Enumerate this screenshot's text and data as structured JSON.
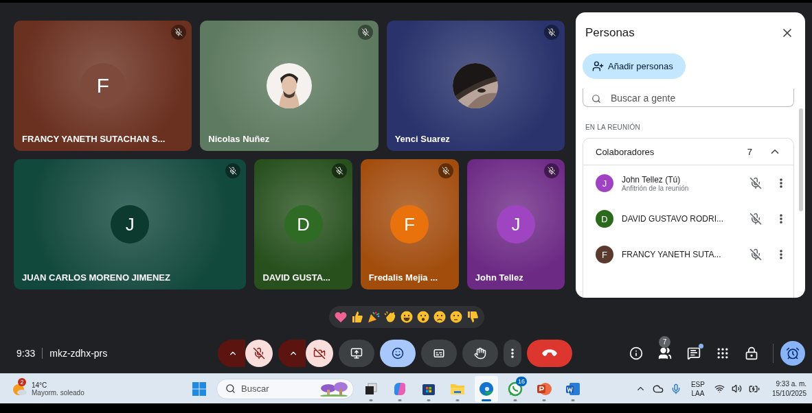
{
  "tiles": [
    [
      {
        "name": "FRANCY YANETH SUTACHAN S...",
        "color": "#6a3020",
        "avatar": {
          "kind": "letter",
          "letter": "F",
          "color": "#7d4a3b"
        }
      },
      {
        "name": "Nicolas Nuñez",
        "color": "#5e7a60"
      },
      {
        "name": "Yenci Suarez",
        "color": "#2a336c"
      }
    ],
    [
      {
        "name": "JUAN CARLOS MORENO JIMENEZ",
        "color": "#12493d",
        "avatar": {
          "kind": "letter",
          "letter": "J",
          "color": "#0d3a2f"
        }
      },
      {
        "name": "DAVID GUSTA...",
        "color": "#27501d",
        "avatar": {
          "kind": "letter",
          "letter": "D",
          "color": "#2f6b24"
        }
      },
      {
        "name": "Fredalis Mejia ...",
        "color": "#a24d0c",
        "avatar": {
          "kind": "letter",
          "letter": "F",
          "color": "#ea720c"
        }
      },
      {
        "name": "John Tellez",
        "color": "#6d2a85",
        "avatar": {
          "kind": "letter",
          "letter": "J",
          "color": "#a045c2"
        }
      }
    ]
  ],
  "panel": {
    "title": "Personas",
    "add_button": "Añadir personas",
    "search": {
      "placeholder": "Buscar a gente"
    },
    "section": "EN LA REUNIÓN",
    "group": {
      "label": "Colaboradores",
      "count": "7",
      "expanded": true,
      "people": [
        {
          "letter": "J",
          "color": "#a142c4",
          "name": "John Tellez (Tú)",
          "subtitle": "Anfitrión de la reunión",
          "muted": true
        },
        {
          "letter": "D",
          "color": "#2b6a1c",
          "name": "DAVID GUSTAVO RODRI...",
          "muted": true
        },
        {
          "letter": "F",
          "color": "#5b3a2e",
          "name": "FRANCY YANETH SUTA...",
          "muted": true
        }
      ]
    }
  },
  "meeting": {
    "time": "9:33",
    "code": "mkz-zdhx-prs"
  },
  "controls": [
    {
      "kind": "mic",
      "on": false
    },
    {
      "kind": "camera",
      "on": false
    },
    {
      "kind": "present",
      "selected": false
    },
    {
      "kind": "reactions",
      "selected": true
    },
    {
      "kind": "captions",
      "selected": false
    },
    {
      "kind": "hand",
      "selected": false
    },
    {
      "kind": "more"
    },
    {
      "kind": "leave"
    }
  ],
  "tools": [
    {
      "kind": "info"
    },
    {
      "kind": "people",
      "badge": "7"
    },
    {
      "kind": "chat",
      "dot": true
    },
    {
      "kind": "apps"
    },
    {
      "kind": "host"
    },
    {
      "kind": "timer",
      "selected": true
    }
  ],
  "taskbar": {
    "weather": {
      "badge": "2",
      "temp": "14°C",
      "condition": "Mayorm. soleado"
    },
    "search": {
      "placeholder": "Buscar"
    },
    "apps": [
      {
        "kind": "taskview",
        "selected": false
      },
      {
        "kind": "copilot",
        "selected": false
      },
      {
        "kind": "store",
        "selected": false
      },
      {
        "kind": "files",
        "selected": false
      },
      {
        "kind": "edge",
        "selected": true
      },
      {
        "kind": "whatsapp",
        "selected": false,
        "badge": "16"
      },
      {
        "kind": "powerpoint",
        "selected": false
      },
      {
        "kind": "word",
        "selected": false
      }
    ],
    "language": [
      "ESP",
      "LAA"
    ],
    "time": "9:33 a. m.",
    "date": "15/10/2025"
  }
}
